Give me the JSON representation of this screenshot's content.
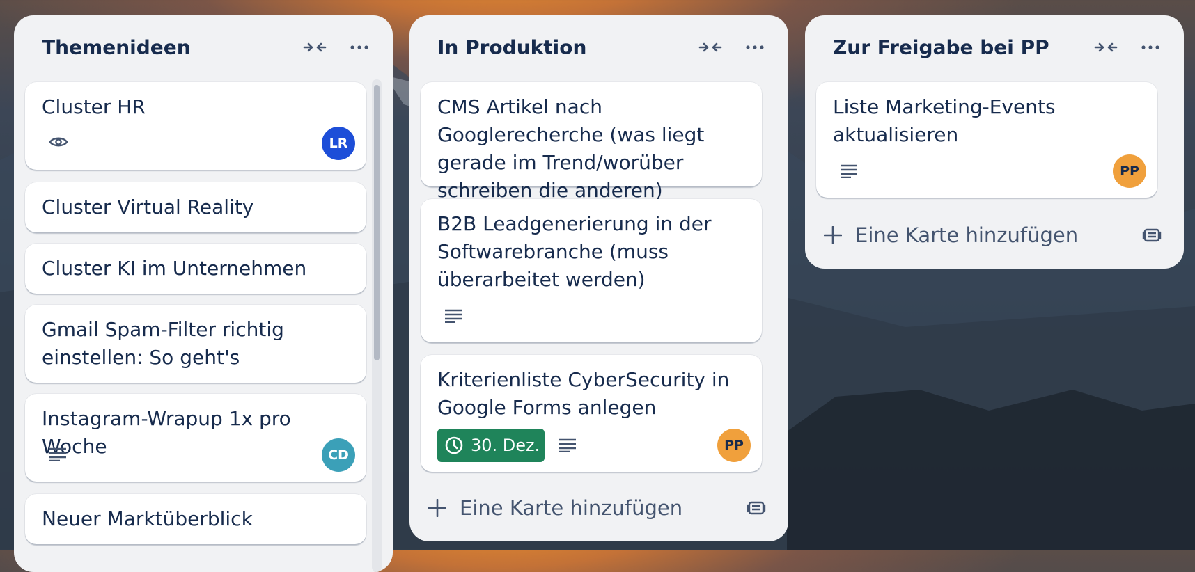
{
  "colors": {
    "list_bg": "#f1f2f4",
    "text": "#172b4d",
    "muted_text": "#44546f",
    "avatar_lr": "#1d4ed8",
    "avatar_cd": "#3ba0b8",
    "avatar_pp": "#f0a03c",
    "date_badge": "#1f845a"
  },
  "lists": [
    {
      "title": "Themenideen",
      "icons": [
        "collapse-icon",
        "more-icon"
      ],
      "cards": [
        {
          "title": "Cluster HR",
          "badges": [
            "watch-icon"
          ],
          "member": "LR"
        },
        {
          "title": "Cluster Virtual Reality"
        },
        {
          "title": "Cluster KI im Unternehmen"
        },
        {
          "title": "Gmail Spam-Filter richtig einstellen: So geht's"
        },
        {
          "title": "Instagram-Wrapup 1x pro Woche",
          "badges": [
            "description-icon"
          ],
          "member": "CD"
        },
        {
          "title": "Neuer Marktüberblick"
        }
      ]
    },
    {
      "title": "In Produktion",
      "icons": [
        "collapse-icon",
        "more-icon"
      ],
      "cards": [
        {
          "title": "CMS Artikel nach Googlerecherche (was liegt gerade im Trend/worüber schreiben die anderen)"
        },
        {
          "title": "B2B Leadgenerierung in der Softwarebranche (muss überarbeitet werden)",
          "badges": [
            "description-icon"
          ]
        },
        {
          "title": "Kriterienliste CyberSecurity in Google Forms anlegen",
          "due": "30. Dez.",
          "badges": [
            "clock-icon",
            "description-icon"
          ],
          "member": "PP"
        }
      ],
      "add_card": "Eine Karte hinzufügen"
    },
    {
      "title": "Zur Freigabe bei PP",
      "icons": [
        "collapse-icon",
        "more-icon"
      ],
      "cards": [
        {
          "title": "Liste Marketing-Events aktualisieren",
          "badges": [
            "description-icon"
          ],
          "member": "PP"
        }
      ],
      "add_card": "Eine Karte hinzufügen"
    }
  ]
}
